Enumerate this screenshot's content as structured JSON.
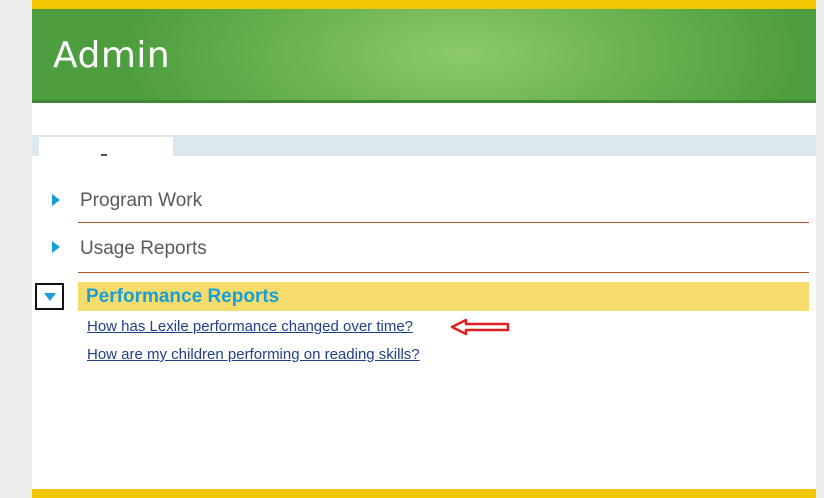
{
  "header": {
    "title": "Admin"
  },
  "sections": [
    {
      "label": "Program Work",
      "expanded": false
    },
    {
      "label": "Usage Reports",
      "expanded": false
    },
    {
      "label": "Performance Reports",
      "expanded": true
    }
  ],
  "performance_reports": {
    "links": [
      "How has Lexile performance changed over time?",
      "How are my children performing on reading skills?"
    ]
  },
  "colors": {
    "header_green": "#6fb652",
    "accent_yellow": "#f2c600",
    "highlight_yellow": "#f6dc6b",
    "link_blue": "#1f3f8a",
    "arrow_blue": "#1a9ed8",
    "annotation_red": "#e02020"
  },
  "icons": [
    "arrow-right-icon",
    "arrow-down-icon",
    "red-pointer-arrow-icon"
  ]
}
